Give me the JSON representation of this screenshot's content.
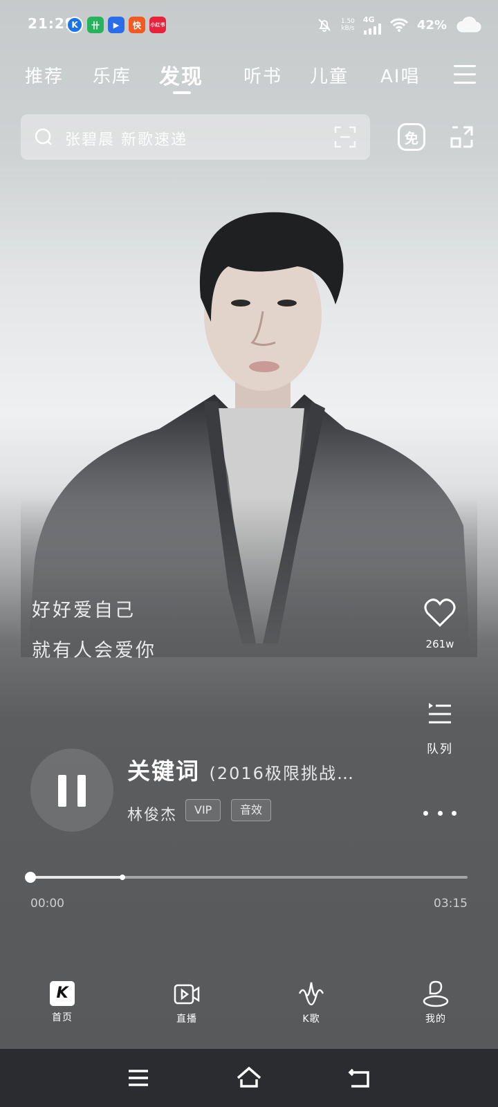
{
  "status_bar": {
    "time": "21:29",
    "apps": [
      {
        "name": "kugou-icon",
        "text": "K",
        "color": "#1a73e8"
      },
      {
        "name": "app-icon-2",
        "text": "卄",
        "color": "#27b35e"
      },
      {
        "name": "video-app-icon",
        "text": "▶",
        "color": "#2b6de8"
      },
      {
        "name": "kuaishou-icon",
        "text": "快",
        "color": "#f25a24"
      },
      {
        "name": "xiaohongshu-icon",
        "text": "小红书",
        "color": "#e8223a"
      }
    ],
    "net_speed_value": "1.50",
    "net_speed_unit": "kB/s",
    "network_type": "4G",
    "battery": "42%"
  },
  "top_tabs": [
    {
      "label": "推荐"
    },
    {
      "label": "乐库"
    },
    {
      "label": "发现",
      "active": true
    },
    {
      "label": "听书"
    },
    {
      "label": "儿童"
    },
    {
      "label": "AI唱"
    }
  ],
  "search": {
    "placeholder": "张碧晨 新歌速递",
    "free_label": "免"
  },
  "lyrics": {
    "line1": "好好爱自己",
    "line2": "就有人会爱你"
  },
  "actions": {
    "like_count": "261w",
    "queue_label": "队列"
  },
  "player": {
    "title": "关键词",
    "subtitle": "(2016极限挑战…",
    "artist": "林俊杰",
    "tag_vip": "VIP",
    "tag_effect": "音效",
    "current_time": "00:00",
    "total_time": "03:15",
    "progress": 0.0,
    "buffered": 0.21
  },
  "bottom_nav": [
    {
      "label": "首页",
      "icon": "home-k-icon",
      "active": true
    },
    {
      "label": "直播",
      "icon": "live-icon"
    },
    {
      "label": "K歌",
      "icon": "karaoke-icon"
    },
    {
      "label": "我的",
      "icon": "profile-icon"
    }
  ],
  "colors": {
    "accent": "#ffffff",
    "system_nav_bg": "#2b2c2f"
  }
}
